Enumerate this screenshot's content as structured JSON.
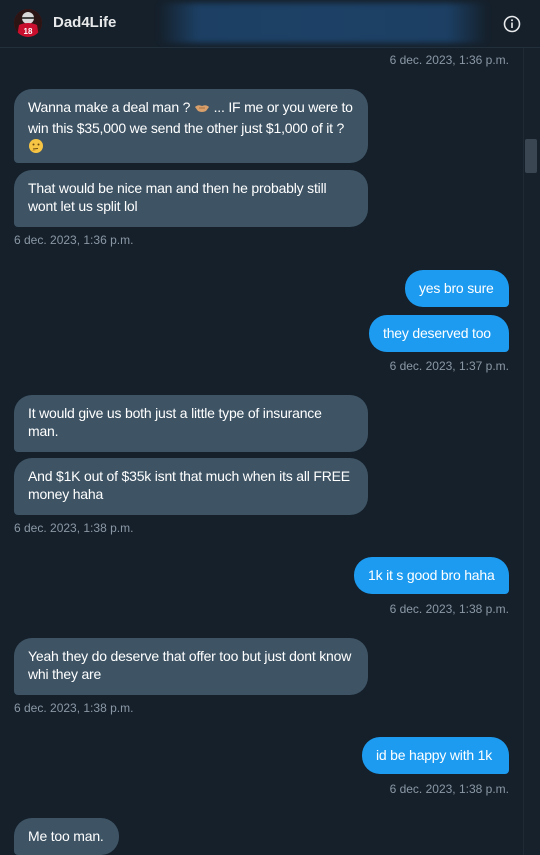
{
  "header": {
    "contact_name": "Dad4Life",
    "avatar_icon": "football-player-avatar-icon",
    "info_icon": "info-icon"
  },
  "messages": [
    {
      "id": "m0",
      "side": "right-timestamp",
      "timestamp": "6 dec. 2023, 1:36 p.m."
    },
    {
      "id": "m1",
      "side": "in",
      "text_a": "Wanna make a deal man ?",
      "emoji_a": "handshake-emoji",
      "text_b": "... IF me or you were to win this $35,000 we send the other just $1,000 of it ?",
      "emoji_b": "thinking-face-emoji"
    },
    {
      "id": "m2",
      "side": "in",
      "text": "That would be nice man and then he probably still wont let us split lol",
      "timestamp": "6 dec. 2023, 1:36 p.m."
    },
    {
      "id": "m3",
      "side": "out",
      "text": "yes bro sure"
    },
    {
      "id": "m4",
      "side": "out",
      "text": "they deserved too",
      "timestamp": "6 dec. 2023, 1:37 p.m."
    },
    {
      "id": "m5",
      "side": "in",
      "text": "It would give us both just a little type of insurance man."
    },
    {
      "id": "m6",
      "side": "in",
      "text": "And $1K out of $35k isnt that much when its all FREE money haha",
      "timestamp": "6 dec. 2023, 1:38 p.m."
    },
    {
      "id": "m7",
      "side": "out",
      "text": "1k it s good bro haha",
      "timestamp": "6 dec. 2023, 1:38 p.m."
    },
    {
      "id": "m8",
      "side": "in",
      "text": "Yeah they do deserve that offer too but just dont know whi they are",
      "timestamp": "6 dec. 2023, 1:38 p.m."
    },
    {
      "id": "m9",
      "side": "out",
      "text": "id be happy with 1k",
      "timestamp": "6 dec. 2023, 1:38 p.m."
    },
    {
      "id": "m10",
      "side": "in",
      "text": "Me too man."
    }
  ],
  "colors": {
    "background": "#15202b",
    "incoming_bubble": "#3e5465",
    "outgoing_bubble": "#1d9bf0",
    "timestamp": "#8b98a5"
  }
}
